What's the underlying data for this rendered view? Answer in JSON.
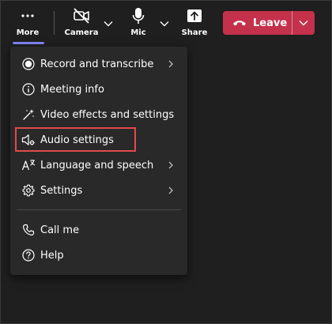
{
  "toolbar": {
    "more": {
      "label": "More",
      "icon": "more-dots-icon"
    },
    "camera": {
      "label": "Camera",
      "icon": "camera-off-icon"
    },
    "mic": {
      "label": "Mic",
      "icon": "mic-icon"
    },
    "share": {
      "label": "Share",
      "icon": "share-icon"
    },
    "leave": {
      "label": "Leave",
      "icon": "phone-hangup-icon",
      "color": "#c4314b"
    }
  },
  "menu": {
    "items": [
      {
        "label": "Record and transcribe",
        "icon": "record-icon",
        "has_submenu": true
      },
      {
        "label": "Meeting info",
        "icon": "info-icon",
        "has_submenu": false
      },
      {
        "label": "Video effects and settings",
        "icon": "magic-wand-icon",
        "has_submenu": false
      },
      {
        "label": "Audio settings",
        "icon": "speaker-settings-icon",
        "has_submenu": false,
        "highlighted": true
      },
      {
        "label": "Language and speech",
        "icon": "language-icon",
        "has_submenu": true
      },
      {
        "label": "Settings",
        "icon": "gear-icon",
        "has_submenu": true
      },
      {
        "label": "Call me",
        "icon": "phone-icon",
        "has_submenu": false
      },
      {
        "label": "Help",
        "icon": "help-icon",
        "has_submenu": false
      }
    ]
  },
  "colors": {
    "background": "#1f1f1f",
    "menu_background": "#292929",
    "accent": "#7f85f5",
    "highlight_border": "#e24a4a"
  }
}
